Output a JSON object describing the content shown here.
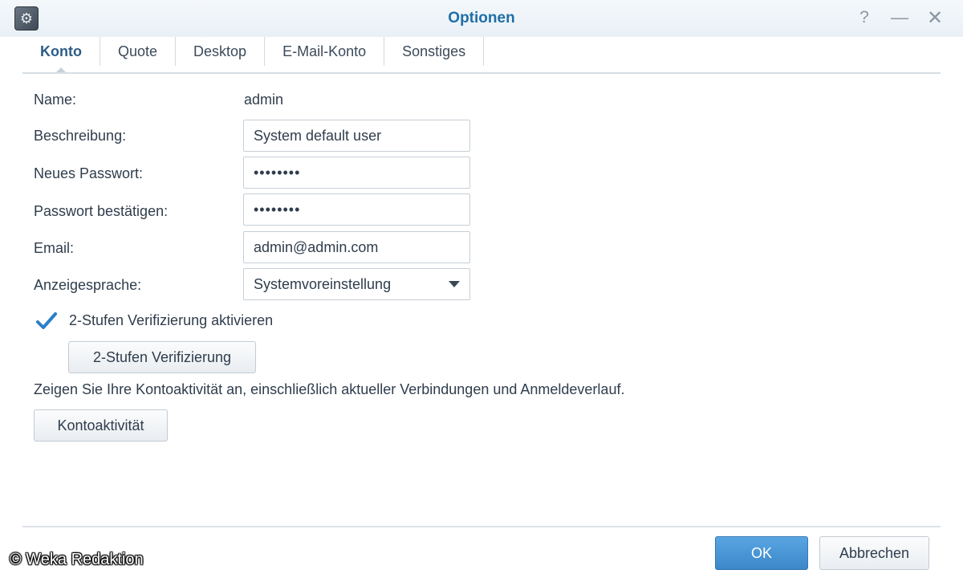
{
  "window": {
    "title": "Optionen",
    "help_glyph": "?",
    "minimize_glyph": "—",
    "close_glyph": "✕"
  },
  "tabs": [
    {
      "label": "Konto",
      "active": true
    },
    {
      "label": "Quote",
      "active": false
    },
    {
      "label": "Desktop",
      "active": false
    },
    {
      "label": "E-Mail-Konto",
      "active": false
    },
    {
      "label": "Sonstiges",
      "active": false
    }
  ],
  "form": {
    "name_label": "Name:",
    "name_value": "admin",
    "description_label": "Beschreibung:",
    "description_value": "System default user",
    "new_password_label": "Neues Passwort:",
    "new_password_value": "••••••••",
    "confirm_password_label": "Passwort bestätigen:",
    "confirm_password_value": "••••••••",
    "email_label": "Email:",
    "email_value": "admin@admin.com",
    "language_label": "Anzeigesprache:",
    "language_value": "Systemvoreinstellung",
    "two_step_checkbox_label": "2-Stufen Verifizierung aktivieren",
    "two_step_checked": true,
    "two_step_button_label": "2-Stufen Verifizierung",
    "activity_info": "Zeigen Sie Ihre Kontoaktivität an, einschließlich aktueller Verbindungen und Anmeldeverlauf.",
    "activity_button_label": "Kontoaktivität"
  },
  "footer": {
    "ok_label": "OK",
    "cancel_label": "Abbrechen"
  },
  "watermark": "© Weka Redaktion",
  "colors": {
    "accent": "#1f6fa8",
    "ok_button": "#4a97d6",
    "checkmark": "#2a7fc9"
  },
  "icons": {
    "app": "gears-icon",
    "checkbox": "checkmark-icon",
    "select": "caret-down-icon"
  }
}
